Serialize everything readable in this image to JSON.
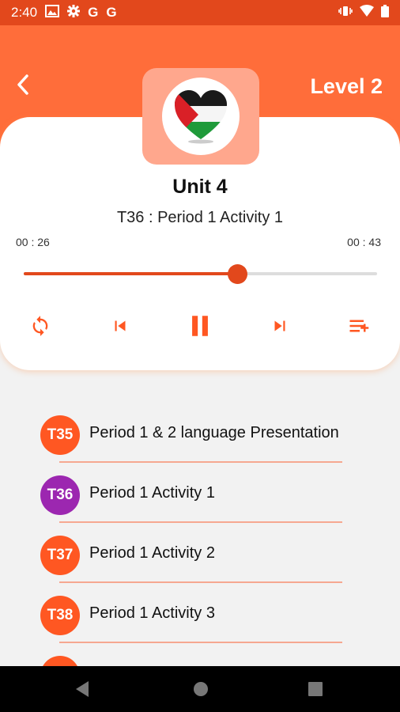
{
  "status_bar": {
    "time": "2:40",
    "left_icons": [
      "image-icon",
      "gear-icon",
      "google-icon",
      "google-icon"
    ],
    "g1": "G",
    "g2": "G",
    "right_icons": [
      "vibrate-icon",
      "wifi-icon",
      "battery-icon"
    ]
  },
  "header": {
    "level_label": "Level 2",
    "accent_color": "#ff6d3a",
    "status_color": "#e2481c"
  },
  "player": {
    "unit_title": "Unit 4",
    "track_title": "T36 : Period 1 Activity 1",
    "elapsed": "00 : 26",
    "total": "00 : 43",
    "progress_fraction": 0.605,
    "controls": [
      "repeat-icon",
      "skip-previous-icon",
      "pause-icon",
      "skip-next-icon",
      "playlist-add-icon"
    ]
  },
  "playlist": {
    "items": [
      {
        "code": "T35",
        "label": "Period 1 & 2 language Presentation",
        "active": false
      },
      {
        "code": "T36",
        "label": "Period 1 Activity 1",
        "active": true
      },
      {
        "code": "T37",
        "label": "Period 1 Activity 2",
        "active": false
      },
      {
        "code": "T38",
        "label": "Period 1 Activity 3",
        "active": false
      }
    ],
    "badge_color": "#ff5722",
    "active_badge_color": "#9c27b0"
  }
}
